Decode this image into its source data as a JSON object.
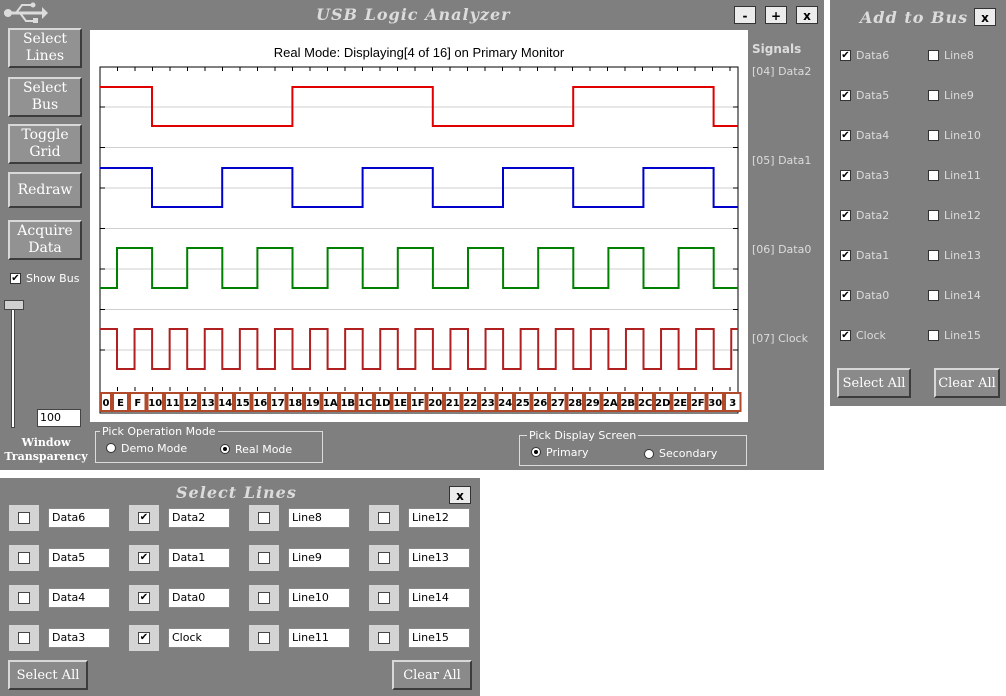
{
  "main_window": {
    "title": "USB Logic Analyzer",
    "controls": {
      "minimize": "-",
      "maximize": "+",
      "close": "x"
    },
    "buttons": {
      "select_lines": "Select\nLines",
      "select_bus": "Select\nBus",
      "toggle_grid": "Toggle\nGrid",
      "redraw": "Redraw",
      "acquire_data": "Acquire\nData"
    },
    "show_bus": {
      "label": "Show Bus",
      "checked": true
    },
    "transparency": {
      "value": "100",
      "label": "Window\nTransparency"
    },
    "plot_title": "Real Mode: Displaying[4 of 16] on Primary Monitor",
    "signals_header": "Signals",
    "signals": [
      "[04] Data2",
      "[05] Data1",
      "[06] Data0",
      "[07] Clock"
    ],
    "bus_values": [
      "0",
      "E",
      "F",
      "10",
      "11",
      "12",
      "13",
      "14",
      "15",
      "16",
      "17",
      "18",
      "19",
      "1A",
      "1B",
      "1C",
      "1D",
      "1E",
      "1F",
      "20",
      "21",
      "22",
      "23",
      "24",
      "25",
      "26",
      "27",
      "28",
      "29",
      "2A",
      "2B",
      "2C",
      "2D",
      "2E",
      "2F",
      "30",
      "3"
    ],
    "operation_mode": {
      "label": "Pick Operation Mode",
      "options": [
        "Demo Mode",
        "Real Mode"
      ],
      "selected": "Real Mode"
    },
    "display_screen": {
      "label": "Pick Display Screen",
      "options": [
        "Primary",
        "Secondary"
      ],
      "selected": "Primary"
    },
    "colors": {
      "data2": "#e00000",
      "data1": "#0000cc",
      "data0": "#008000",
      "clock": "#b02020"
    }
  },
  "add_to_bus": {
    "title": "Add to Bus",
    "close": "x",
    "left_items": [
      {
        "label": "Data6",
        "checked": true
      },
      {
        "label": "Data5",
        "checked": true
      },
      {
        "label": "Data4",
        "checked": true
      },
      {
        "label": "Data3",
        "checked": true
      },
      {
        "label": "Data2",
        "checked": true
      },
      {
        "label": "Data1",
        "checked": true
      },
      {
        "label": "Data0",
        "checked": true
      },
      {
        "label": "Clock",
        "checked": true
      }
    ],
    "right_items": [
      {
        "label": "Line8",
        "checked": false
      },
      {
        "label": "Line9",
        "checked": false
      },
      {
        "label": "Line10",
        "checked": false
      },
      {
        "label": "Line11",
        "checked": false
      },
      {
        "label": "Line12",
        "checked": false
      },
      {
        "label": "Line13",
        "checked": false
      },
      {
        "label": "Line14",
        "checked": false
      },
      {
        "label": "Line15",
        "checked": false
      }
    ],
    "select_all": "Select All",
    "clear_all": "Clear All"
  },
  "select_lines": {
    "title": "Select Lines",
    "close": "x",
    "rows": [
      [
        {
          "label": "Data6",
          "checked": false
        },
        {
          "label": "Data2",
          "checked": true
        },
        {
          "label": "Line8",
          "checked": false
        },
        {
          "label": "Line12",
          "checked": false
        }
      ],
      [
        {
          "label": "Data5",
          "checked": false
        },
        {
          "label": "Data1",
          "checked": true
        },
        {
          "label": "Line9",
          "checked": false
        },
        {
          "label": "Line13",
          "checked": false
        }
      ],
      [
        {
          "label": "Data4",
          "checked": false
        },
        {
          "label": "Data0",
          "checked": true
        },
        {
          "label": "Line10",
          "checked": false
        },
        {
          "label": "Line14",
          "checked": false
        }
      ],
      [
        {
          "label": "Data3",
          "checked": false
        },
        {
          "label": "Clock",
          "checked": true
        },
        {
          "label": "Line11",
          "checked": false
        },
        {
          "label": "Line15",
          "checked": false
        }
      ]
    ],
    "select_all": "Select All",
    "clear_all": "Clear All"
  }
}
